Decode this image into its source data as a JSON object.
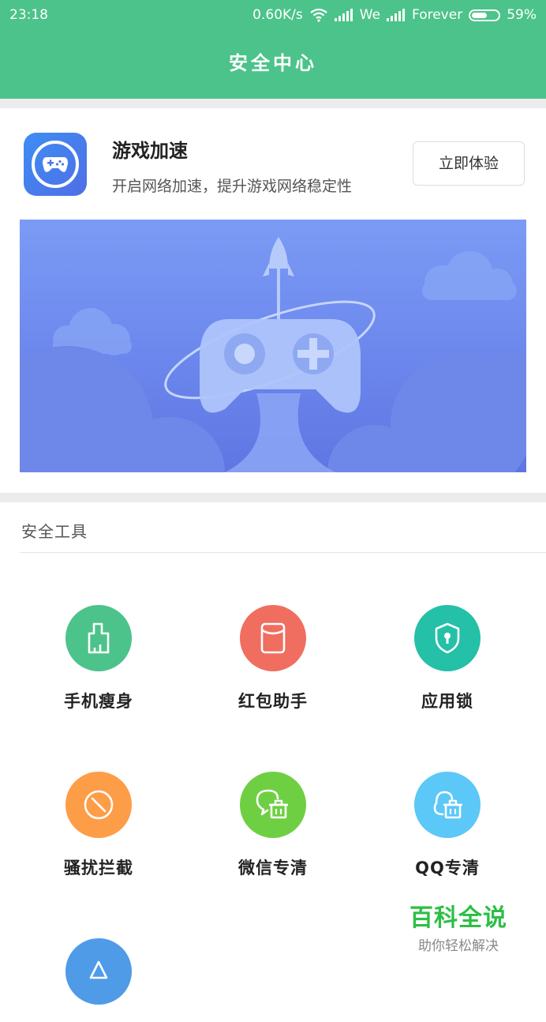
{
  "status_bar": {
    "time": "23:18",
    "speed": "0.60K/s",
    "carrier1": "We",
    "carrier2": "Forever",
    "battery": "59%",
    "battery_level": 0.59
  },
  "header": {
    "title": "安全中心"
  },
  "feature": {
    "title": "游戏加速",
    "desc": "开启网络加速，提升游戏网络稳定性",
    "button": "立即体验",
    "icon": "gamepad-icon"
  },
  "section": {
    "title": "安全工具"
  },
  "tools": [
    {
      "label": "手机瘦身",
      "icon": "broom-icon",
      "color": "#4cc38a"
    },
    {
      "label": "红包助手",
      "icon": "red-packet-icon",
      "color": "#f06e60"
    },
    {
      "label": "应用锁",
      "icon": "shield-lock-icon",
      "color": "#24c0a7"
    },
    {
      "label": "骚扰拦截",
      "icon": "block-icon",
      "color": "#fe9d47"
    },
    {
      "label": "微信专清",
      "icon": "wechat-clean-icon",
      "color": "#6fcf43"
    },
    {
      "label": "QQ专清",
      "icon": "qq-clean-icon",
      "color": "#5bc8f7"
    },
    {
      "label": "",
      "icon": "app-store-icon",
      "color": "#4f9be8"
    }
  ],
  "watermark": {
    "main": "百科全说",
    "sub": "助你轻松解决"
  }
}
